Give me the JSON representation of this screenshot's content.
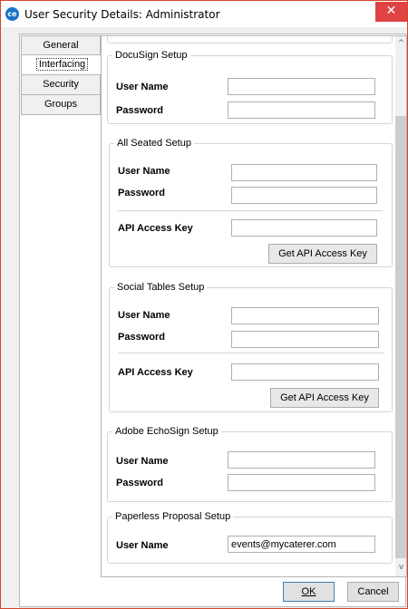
{
  "window": {
    "app_icon": "ce-logo-icon",
    "title": "User Security Details:  Administrator",
    "close_glyph": "✕"
  },
  "tabs": [
    {
      "label": "General",
      "active": false
    },
    {
      "label": "Interfacing",
      "active": true
    },
    {
      "label": "Security",
      "active": false
    },
    {
      "label": "Groups",
      "active": false
    }
  ],
  "docusign": {
    "legend": "DocuSign Setup",
    "user_name_label": "User Name",
    "user_name_value": "",
    "password_label": "Password",
    "password_value": ""
  },
  "all_seated": {
    "legend": "All Seated Setup",
    "user_name_label": "User Name",
    "user_name_value": "",
    "password_label": "Password",
    "password_value": "",
    "api_key_label": "API Access Key",
    "api_key_value": "",
    "get_key_button": "Get API Access Key"
  },
  "social_tables": {
    "legend": "Social Tables Setup",
    "user_name_label": "User Name",
    "user_name_value": "",
    "password_label": "Password",
    "password_value": "",
    "api_key_label": "API Access Key",
    "api_key_value": "",
    "get_key_button": "Get API Access Key"
  },
  "adobe_echosign": {
    "legend": "Adobe EchoSign Setup",
    "user_name_label": "User Name",
    "user_name_value": "",
    "password_label": "Password",
    "password_value": ""
  },
  "paperless_proposal": {
    "legend": "Paperless Proposal Setup",
    "user_name_label": "User Name",
    "user_name_value": "events@mycaterer.com"
  },
  "scrollbar": {
    "up_glyph": "^",
    "down_glyph": "v"
  },
  "footer": {
    "ok_label": "OK",
    "cancel_label": "Cancel"
  }
}
